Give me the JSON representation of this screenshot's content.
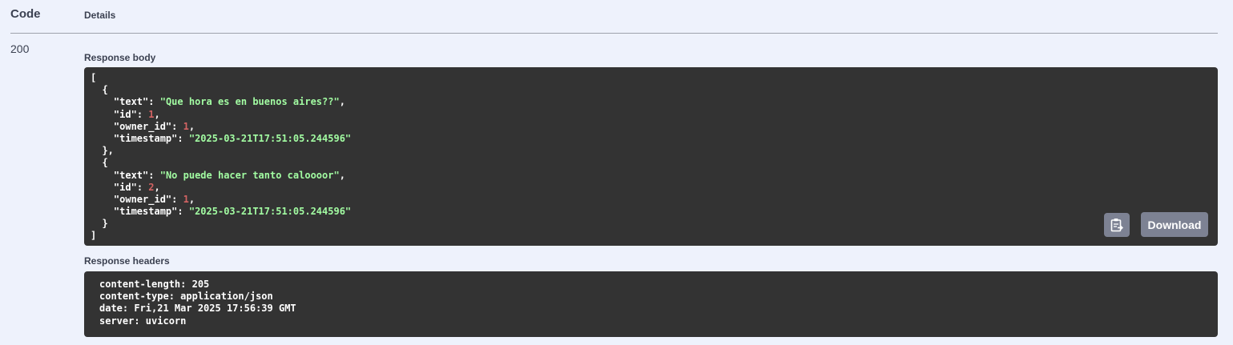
{
  "table": {
    "code_header": "Code",
    "details_header": "Details"
  },
  "response": {
    "status_code": "200",
    "body_label": "Response body",
    "headers_label": "Response headers",
    "body": [
      {
        "text": "Que hora es en buenos aires??",
        "id": "1",
        "owner_id": "1",
        "timestamp": "2025-03-21T17:51:05.244596"
      },
      {
        "text": "No puede hacer tanto caloooor",
        "id": "2",
        "owner_id": "1",
        "timestamp": "2025-03-21T17:51:05.244596"
      }
    ],
    "headers": [
      "content-length: 205",
      "content-type: application/json",
      "date: Fri,21 Mar 2025 17:56:39 GMT",
      "server: uvicorn"
    ],
    "download_label": "Download",
    "copy_icon": "clipboard-copy-icon"
  },
  "colors": {
    "background": "#eef2fc",
    "code_bg": "#333333",
    "string": "#a2fca2",
    "number": "#d36363",
    "button_bg": "#7d8293"
  }
}
